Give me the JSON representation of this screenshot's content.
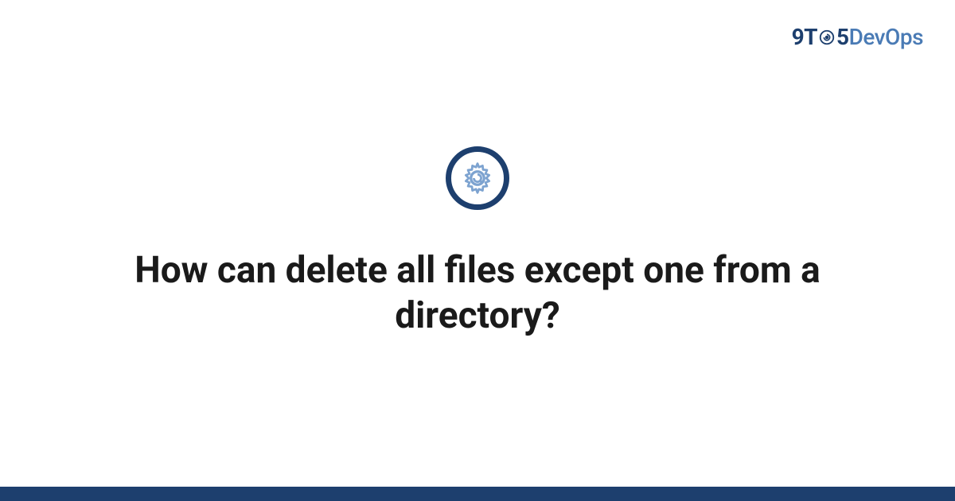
{
  "brand": {
    "part1": "9T",
    "part2": "5",
    "part3": "DevOps"
  },
  "headline": "How can delete all files except one from a directory?",
  "colors": {
    "darkBlue": "#1d3f6e",
    "lightBlue": "#4a7bb5",
    "gearBlue": "#7da3d0"
  }
}
